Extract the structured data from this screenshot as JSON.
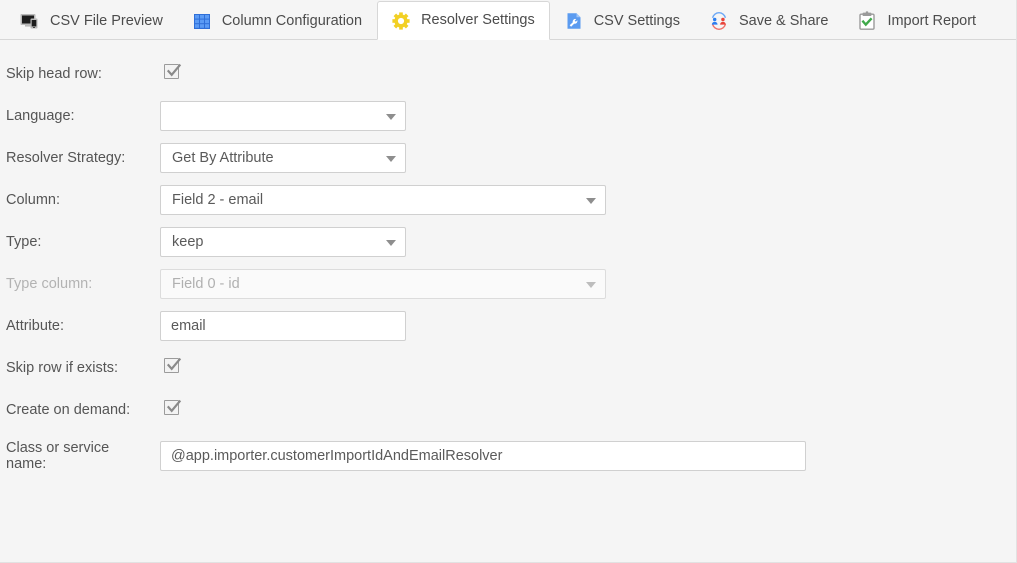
{
  "tabs": [
    {
      "label": "CSV File Preview",
      "icon": "monitor-icon",
      "active": false
    },
    {
      "label": "Column Configuration",
      "icon": "grid-icon",
      "active": false
    },
    {
      "label": "Resolver Settings",
      "icon": "gear-icon",
      "active": true
    },
    {
      "label": "CSV Settings",
      "icon": "wrench-doc-icon",
      "active": false
    },
    {
      "label": "Save & Share",
      "icon": "users-icon",
      "active": false
    },
    {
      "label": "Import Report",
      "icon": "clipboard-check-icon",
      "active": false
    }
  ],
  "form": {
    "skip_head_row": {
      "label": "Skip head row:",
      "checked": "checked"
    },
    "language": {
      "label": "Language:",
      "value": ""
    },
    "resolver_strategy": {
      "label": "Resolver Strategy:",
      "value": "Get By Attribute"
    },
    "column": {
      "label": "Column:",
      "value": "Field 2 - email"
    },
    "type": {
      "label": "Type:",
      "value": "keep"
    },
    "type_column": {
      "label": "Type column:",
      "value": "Field 0 - id",
      "state": "disabled"
    },
    "attribute": {
      "label": "Attribute:",
      "value": "email"
    },
    "skip_row_if_exists": {
      "label": "Skip row if exists:",
      "checked": "checked"
    },
    "create_on_demand": {
      "label": "Create on demand:",
      "checked": "checked"
    },
    "class_or_service_name": {
      "label": "Class or service name:",
      "value": "@app.importer.customerImportIdAndEmailResolver"
    }
  },
  "colors": {
    "page_background": "#f5f5f5",
    "active_tab_background": "#ffffff",
    "gear_yellow": "#f2d024",
    "grid_blue": "#3b85f0",
    "doc_blue": "#5b9bf0",
    "person_blue": "#2d7ff0",
    "person_red": "#e8443a",
    "check_green": "#3fa94a",
    "text": "#555555"
  }
}
